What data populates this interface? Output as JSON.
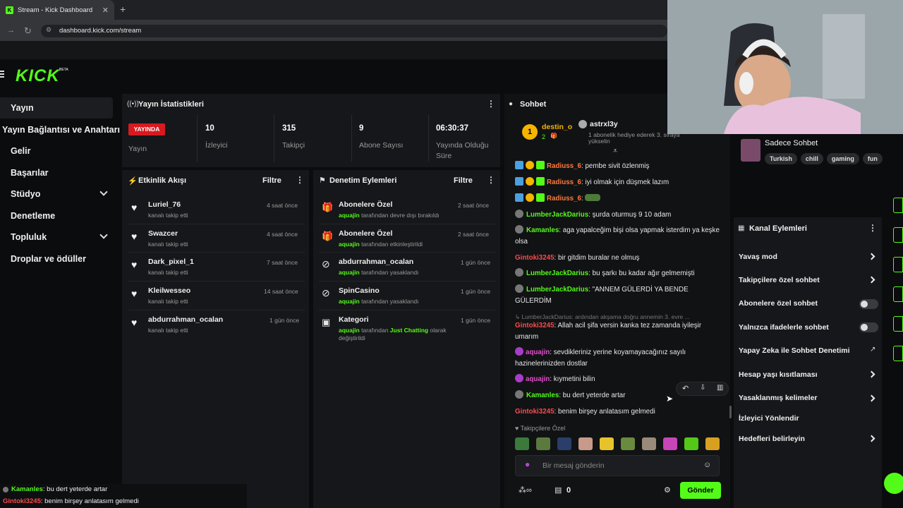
{
  "browser": {
    "tab_title": "Stream - Kick Dashboard",
    "tab_close": "✕",
    "new_tab": "+",
    "url": "dashboard.kick.com/stream"
  },
  "brand": {
    "logo": "KICK",
    "beta": "BETA",
    "accent": "#53fc18"
  },
  "sidebar": {
    "items": [
      {
        "label": "Yayın"
      },
      {
        "label": "Yayın Bağlantısı ve Anahtarı"
      },
      {
        "label": "Gelir"
      },
      {
        "label": "Başarılar"
      },
      {
        "label": "Stüdyo"
      },
      {
        "label": "Denetleme"
      },
      {
        "label": "Topluluk"
      },
      {
        "label": "Droplar ve ödüller"
      }
    ]
  },
  "stats": {
    "title": "Yayın İstatistikleri",
    "live_badge": "YAYINDA",
    "status_label": "Yayın",
    "viewers": {
      "value": "10",
      "label": "İzleyici"
    },
    "followers": {
      "value": "315",
      "label": "Takipçi"
    },
    "subs": {
      "value": "9",
      "label": "Abone Sayısı"
    },
    "uptime": {
      "value": "06:30:37",
      "label": "Yayında Olduğu Süre"
    }
  },
  "activity": {
    "title": "Etkinlik Akışı",
    "filter": "Filtre",
    "items": [
      {
        "name": "Luriel_76",
        "sub": "kanalı takip etti",
        "time": "4 saat önce"
      },
      {
        "name": "Swazcer",
        "sub": "kanalı takip etti",
        "time": "4 saat önce"
      },
      {
        "name": "Dark_pixel_1",
        "sub": "kanalı takip etti",
        "time": "7 saat önce"
      },
      {
        "name": "Kleilwesseo",
        "sub": "kanalı takip etti",
        "time": "14 saat önce"
      },
      {
        "name": "abdurrahman_ocalan",
        "sub": "kanalı takip etti",
        "time": "1 gün önce"
      }
    ]
  },
  "moderation": {
    "title": "Denetim Eylemleri",
    "filter": "Filtre",
    "items": [
      {
        "name": "Abonelere Özel",
        "user": "aquajin",
        "sub": "tarafından devre dışı bırakıldı",
        "time": "2 saat önce"
      },
      {
        "name": "Abonelere Özel",
        "user": "aquajin",
        "sub": "tarafından etkinleştirildi",
        "time": "2 saat önce"
      },
      {
        "name": "abdurrahman_ocalan",
        "user": "aquajin",
        "sub": "tarafından yasaklandı",
        "time": "1 gün önce"
      },
      {
        "name": "SpinCasino",
        "user": "aquajin",
        "sub": "tarafından yasaklandı",
        "time": "1 gün önce"
      },
      {
        "name": "Kategori",
        "user": "aquajin",
        "sub": "tarafından",
        "category": "Just Chatting",
        "sub2": "olarak değiştirildi",
        "time": "1 gün önce"
      }
    ]
  },
  "chat": {
    "title": "Sohbet",
    "pinned_user1": "destin_o",
    "pinned_count": "2",
    "pinned_user2": "astrxl3y",
    "pinned_note": "1 abonelik hediye ederek 3. sıraya yükselin",
    "messages": [
      {
        "user": "Radiuss_6",
        "text": ": pembe sivit özlenmiş"
      },
      {
        "user": "Radiuss_6",
        "text": ": iyi olmak için düşmek lazım"
      },
      {
        "user": "Radiuss_6",
        "text": ":"
      },
      {
        "user": "LumberJackDarius",
        "text": ": şurda oturmuş 9 10 adam"
      },
      {
        "user": "Kamanles",
        "text": ": aga yapalceğim bişi olsa yapmak isterdim ya keşke olsa"
      },
      {
        "user": "Gintoki3245",
        "text": ": bir gitdim buralar ne olmuş"
      },
      {
        "user": "LumberJackDarius",
        "text": ": bu şarkı bu kadar ağır gelmemişti"
      },
      {
        "user": "LumberJackDarius",
        "text": ": \"ANNEM GÜLERDİ YA BENDE GÜLERDİM"
      },
      {
        "reply": "↳ LumberJackDarius: ardından akşama doğru annemin 3. evre ..."
      },
      {
        "user": "Gintoki3245",
        "text": ": Allah acil şifa versin kanka tez zamanda iyileşir umarım"
      },
      {
        "user": "aquajin",
        "text": ": sevdikleriniz yerine koyamayacağınız sayılı hazinelerinizden dostlar"
      },
      {
        "user": "aquajin",
        "text": ": kıymetini bilin"
      },
      {
        "user": "Kamanles",
        "text": ": bu dert yeterde artar"
      },
      {
        "user": "Gintoki3245",
        "text": ": benim birşey anlatasım gelmedi"
      }
    ],
    "follower_only": "♥ Takipçilere Özel",
    "placeholder": "Bir mesaj gönderin",
    "points": "0",
    "send": "Gönder"
  },
  "channel": {
    "chat_label": "Sadece Sohbet",
    "tags": [
      "Turkish",
      "chill",
      "gaming",
      "fun"
    ]
  },
  "actions": {
    "title": "Kanal Eylemleri",
    "items": [
      {
        "label": "Yavaş mod",
        "type": "chevron"
      },
      {
        "label": "Takipçilere özel sohbet",
        "type": "chevron"
      },
      {
        "label": "Abonelere özel sohbet",
        "type": "toggle"
      },
      {
        "label": "Yalnızca ifadelerle sohbet",
        "type": "toggle"
      },
      {
        "label": "Yapay Zeka ile Sohbet Denetimi",
        "type": "external"
      },
      {
        "label": "Hesap yaşı kısıtlaması",
        "type": "chevron"
      },
      {
        "label": "Yasaklanmış kelimeler",
        "type": "chevron"
      },
      {
        "label": "İzleyici Yönlendir",
        "type": "none"
      },
      {
        "label": "Hedefleri belirleyin",
        "type": "chevron"
      }
    ]
  },
  "overlay_chat": [
    {
      "user": "Kamanles",
      "text": ": bu dert yeterde artar"
    },
    {
      "user": "Gintoki3245",
      "text": ": benim birşey anlatasım gelmedi"
    }
  ]
}
